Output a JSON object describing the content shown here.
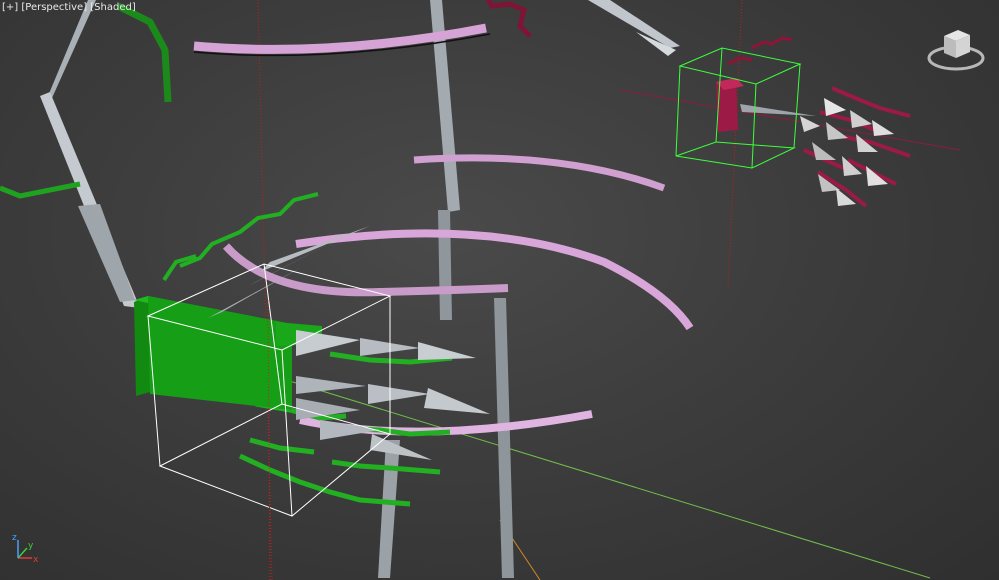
{
  "viewport": {
    "menu_plus": "[+]",
    "menu_view": "[Perspective]",
    "menu_shading": "[Shaded]"
  },
  "navigation": {
    "viewcube_icon": "viewcube-icon",
    "axis_icon": "axis-tripod-icon"
  },
  "axis_labels": {
    "x": "x",
    "y": "y",
    "z": "z"
  },
  "colors": {
    "background": "#3d3d3d",
    "selection_white": "#ffffff",
    "selection_green": "#3cff3c",
    "green_objects": "#1fa21f",
    "pink_objects": "#d79ed7",
    "crimson_objects": "#9b1a46",
    "grey_objects": "#b9bec4",
    "grid_red": "#c21c1c",
    "grid_green": "#4db34d",
    "axis_blue": "#4aa0ff"
  }
}
